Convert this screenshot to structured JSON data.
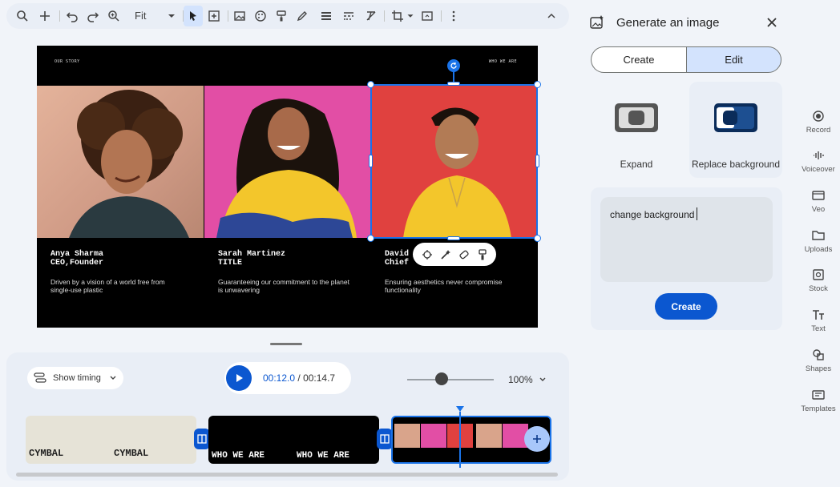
{
  "toolbar": {
    "zoom_label": "Fit"
  },
  "slide": {
    "left_label": "OUR STORY",
    "right_label": "WHO WE ARE",
    "people": [
      {
        "name": "Anya Sharma",
        "title": "CEO,Founder",
        "desc": "Driven by a vision of a world free from single-use plastic"
      },
      {
        "name": "Sarah Martinez",
        "title": "TITLE",
        "desc": "Guaranteeing our commitment to the planet is unwavering"
      },
      {
        "name": "David",
        "title": "Chief",
        "desc": "Ensuring aesthetics never compromise functionality"
      }
    ]
  },
  "timeline": {
    "show_timing": "Show timing",
    "time_current": "00:12.0",
    "time_separator": " / ",
    "time_total": "00:14.7",
    "zoom_percent": "100%",
    "zoom_level": 0.4,
    "clips": [
      {
        "text_a": "CYMBAL",
        "text_b": "CYMBAL"
      },
      {
        "text_a": "WHO WE ARE",
        "text_b": "WHO WE ARE"
      }
    ]
  },
  "panel": {
    "title": "Generate an image",
    "tab_create": "Create",
    "tab_edit": "Edit",
    "option_expand": "Expand",
    "option_replace": "Replace background",
    "prompt_value": "change background",
    "create_button": "Create"
  },
  "rail": [
    {
      "label": "Record",
      "icon": "record-icon"
    },
    {
      "label": "Voiceover",
      "icon": "voiceover-icon"
    },
    {
      "label": "Veo",
      "icon": "veo-icon"
    },
    {
      "label": "Uploads",
      "icon": "folder-icon"
    },
    {
      "label": "Stock",
      "icon": "stock-icon"
    },
    {
      "label": "Text",
      "icon": "text-icon"
    },
    {
      "label": "Shapes",
      "icon": "shapes-icon"
    },
    {
      "label": "Templates",
      "icon": "templates-icon"
    }
  ],
  "colors": {
    "accent": "#0b57d0",
    "selection": "#1a73e8",
    "tab_active": "#d3e3fd"
  }
}
